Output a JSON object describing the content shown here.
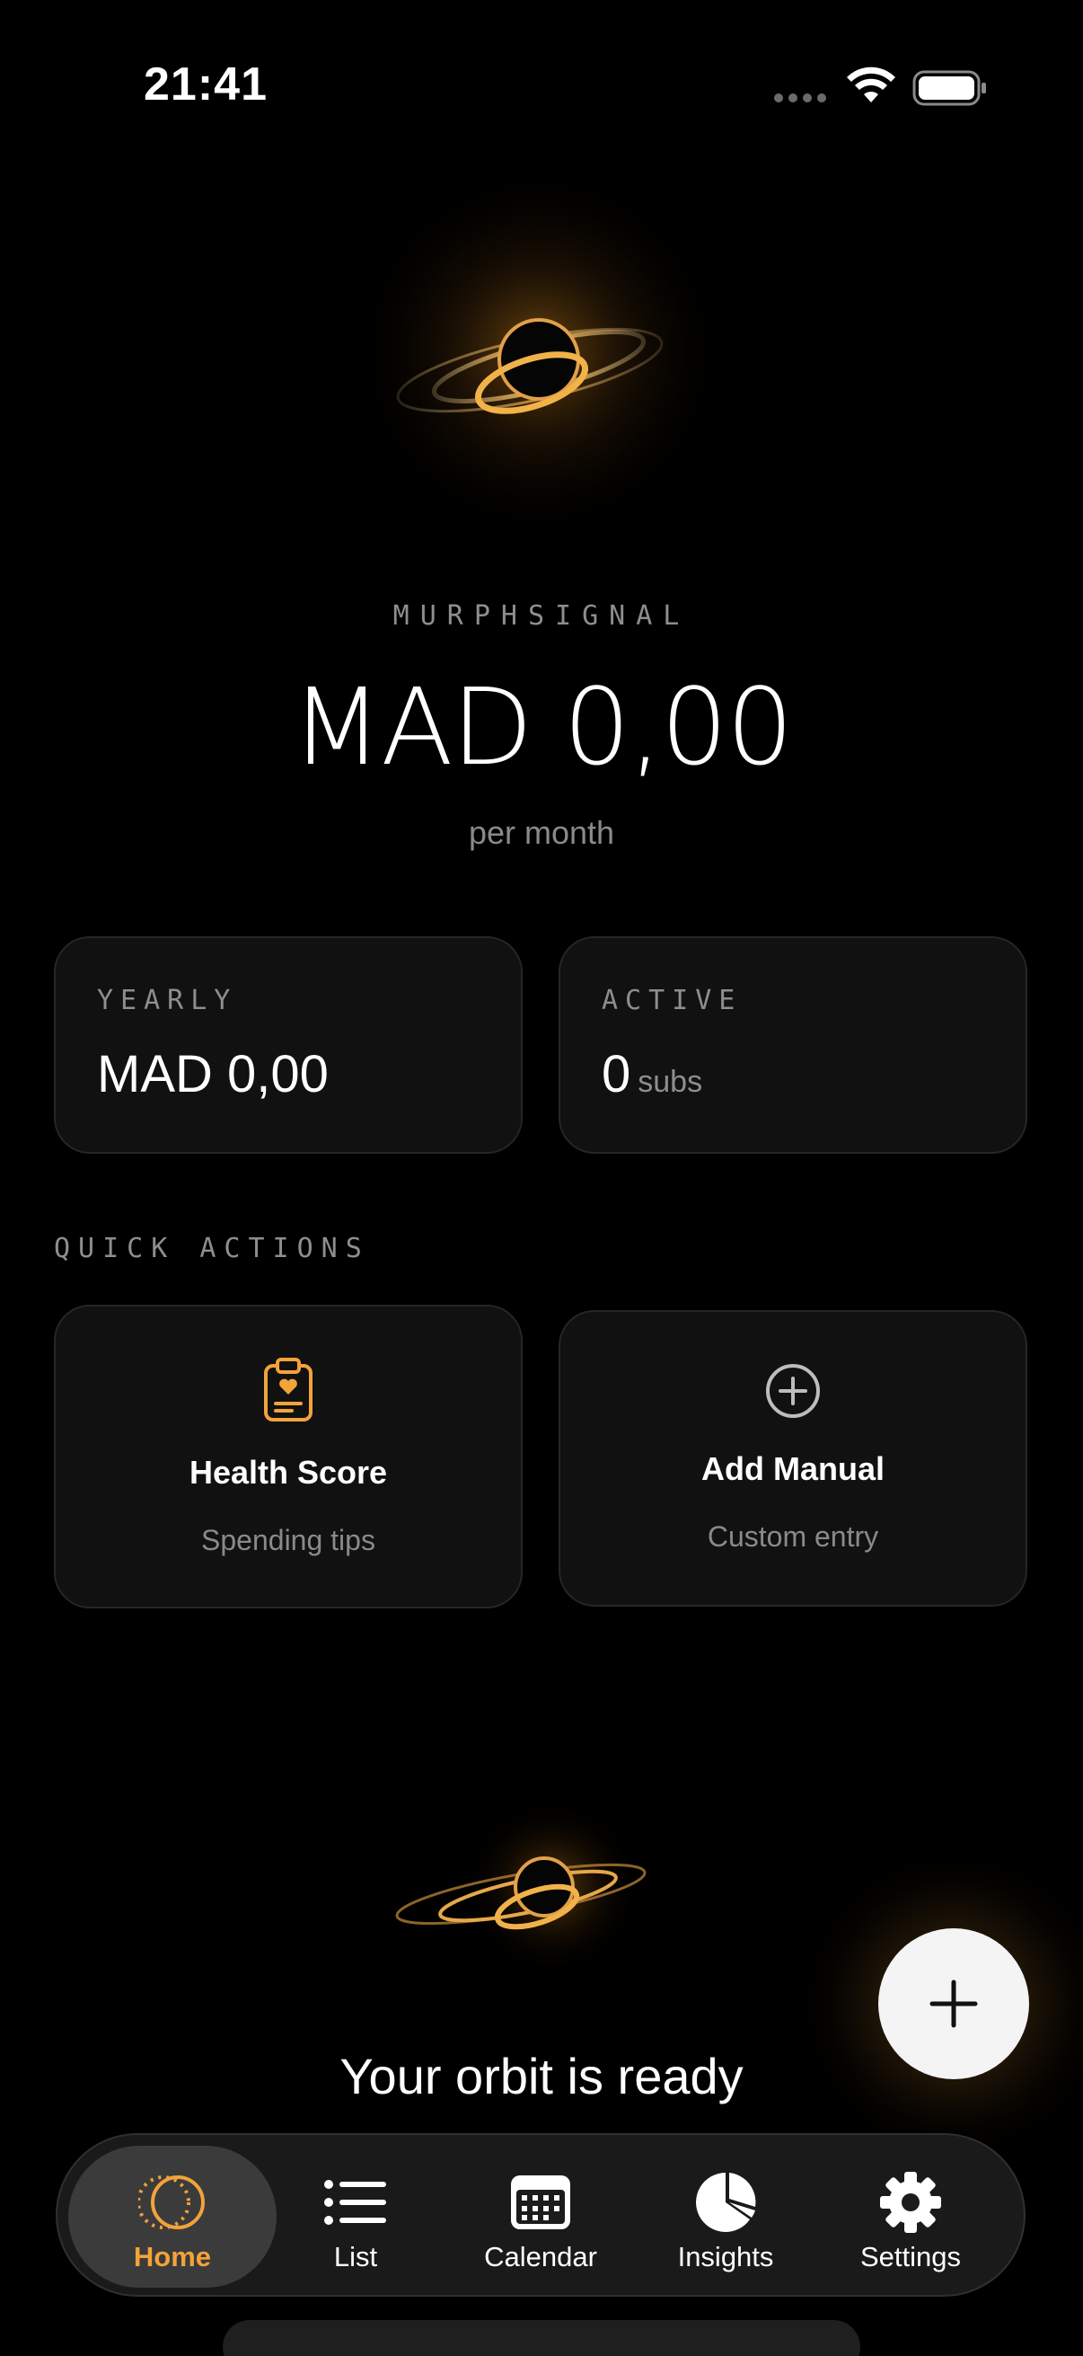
{
  "status_bar": {
    "time": "21:41"
  },
  "brand": "MURPHSIGNAL",
  "monthly_total": "MAD 0,00",
  "period_label": "per month",
  "stats": {
    "yearly": {
      "label": "YEARLY",
      "value": "MAD 0,00"
    },
    "active": {
      "label": "ACTIVE",
      "value": "0",
      "unit": "subs"
    }
  },
  "quick_actions": {
    "title": "QUICK ACTIONS",
    "items": [
      {
        "title": "Health Score",
        "subtitle": "Spending tips",
        "icon": "clipboard-heart-icon"
      },
      {
        "title": "Add Manual",
        "subtitle": "Custom entry",
        "icon": "plus-circle-icon"
      }
    ]
  },
  "empty_state": {
    "title": "Your orbit is ready"
  },
  "fab": {
    "icon": "plus-icon"
  },
  "tabs": [
    {
      "label": "Home",
      "icon": "orbit-icon",
      "active": true
    },
    {
      "label": "List",
      "icon": "list-icon",
      "active": false
    },
    {
      "label": "Calendar",
      "icon": "calendar-icon",
      "active": false
    },
    {
      "label": "Insights",
      "icon": "pie-chart-icon",
      "active": false
    },
    {
      "label": "Settings",
      "icon": "gear-icon",
      "active": false
    }
  ],
  "colors": {
    "accent": "#F2A33A",
    "background": "#000000",
    "card": "#111111"
  }
}
